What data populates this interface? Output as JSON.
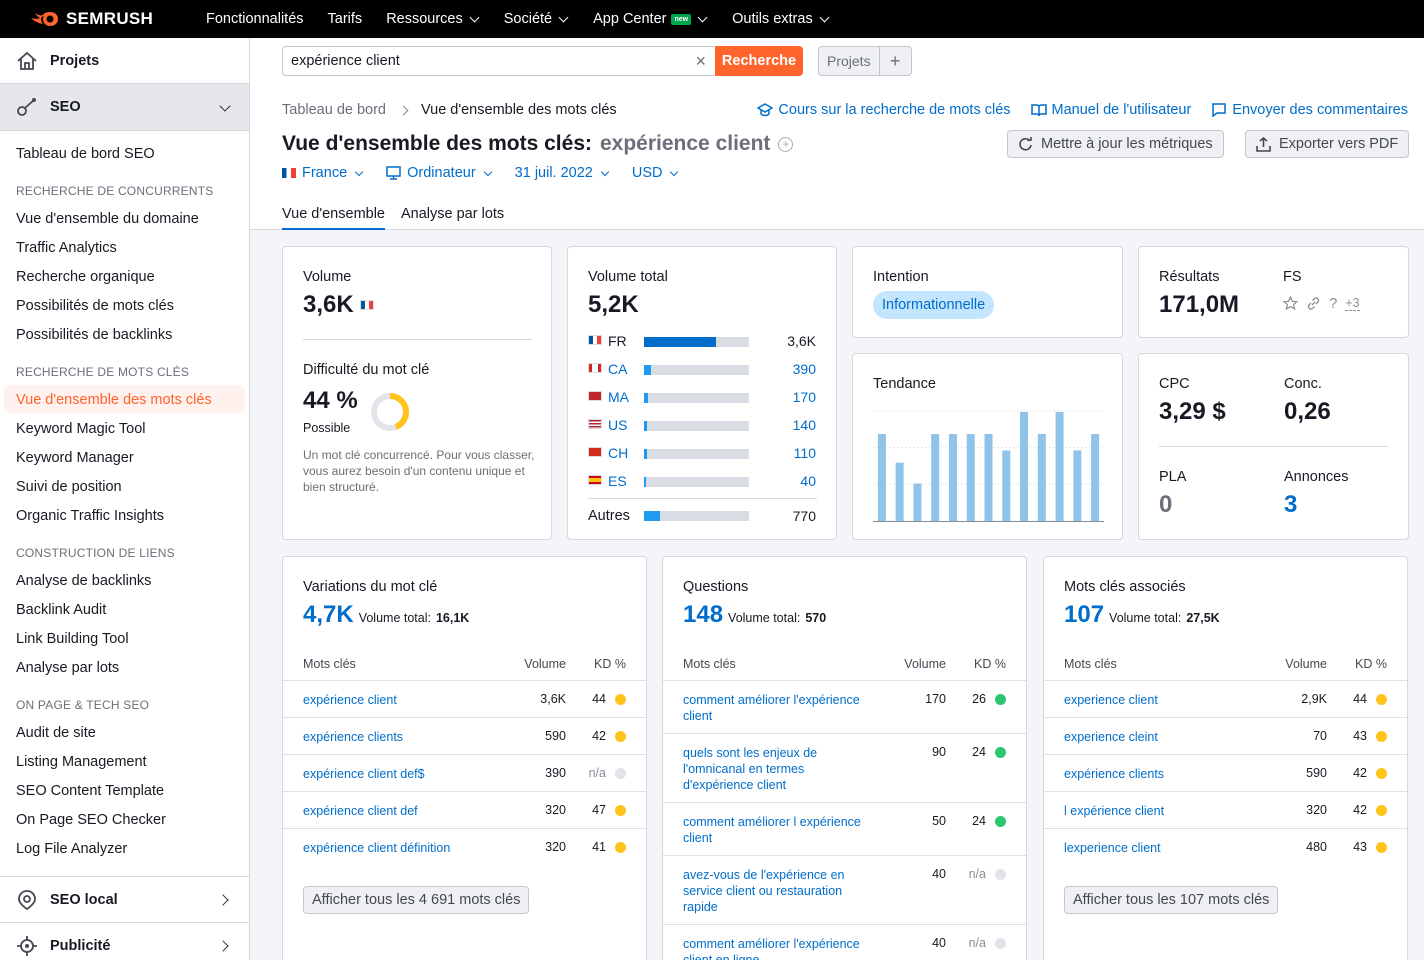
{
  "topbar": {
    "logo": "SEMRUSH",
    "nav": [
      {
        "label": "Fonctionnalités",
        "dropdown": false
      },
      {
        "label": "Tarifs",
        "dropdown": false
      },
      {
        "label": "Ressources",
        "dropdown": true
      },
      {
        "label": "Société",
        "dropdown": true
      },
      {
        "label": "App Center",
        "dropdown": true,
        "badge": "new"
      },
      {
        "label": "Outils extras",
        "dropdown": true
      }
    ]
  },
  "sidebar": {
    "projects": "Projets",
    "seo": "SEO",
    "dashboard": "Tableau de bord SEO",
    "groups": [
      {
        "title": "RECHERCHE DE CONCURRENTS",
        "items": [
          "Vue d'ensemble du domaine",
          "Traffic Analytics",
          "Recherche organique",
          "Possibilités de mots clés",
          "Possibilités de backlinks"
        ]
      },
      {
        "title": "RECHERCHE DE MOTS CLÉS",
        "items": [
          "Vue d'ensemble des mots clés",
          "Keyword Magic Tool",
          "Keyword Manager",
          "Suivi de position",
          "Organic Traffic Insights"
        ]
      },
      {
        "title": "CONSTRUCTION DE LIENS",
        "items": [
          "Analyse de backlinks",
          "Backlink Audit",
          "Link Building Tool",
          "Analyse par lots"
        ]
      },
      {
        "title": "ON PAGE & TECH SEO",
        "items": [
          "Audit de site",
          "Listing Management",
          "SEO Content Template",
          "On Page SEO Checker",
          "Log File Analyzer"
        ]
      }
    ],
    "active_item": "Vue d'ensemble des mots clés",
    "local_seo": "SEO local",
    "ads": "Publicité"
  },
  "search": {
    "value": "expérience client",
    "button": "Recherche",
    "projects": "Projets",
    "plus": "+"
  },
  "breadcrumb": {
    "root": "Tableau de bord",
    "current": "Vue d'ensemble des mots clés"
  },
  "toplinks": {
    "course": "Cours sur la recherche de mots clés",
    "manual": "Manuel de l'utilisateur",
    "feedback": "Envoyer des commentaires"
  },
  "title": {
    "prefix": "Vue d'ensemble des mots clés:",
    "keyword": "expérience client"
  },
  "buttons": {
    "update": "Mettre à jour les métriques",
    "export": "Exporter vers PDF"
  },
  "filters": {
    "country": "France",
    "device": "Ordinateur",
    "date": "31 juil. 2022",
    "currency": "USD"
  },
  "tabs": [
    "Vue d'ensemble",
    "Analyse par lots"
  ],
  "volume": {
    "label": "Volume",
    "value": "3,6K",
    "kd_label": "Difficulté du mot clé",
    "kd_value": "44 %",
    "kd_percent": 44,
    "kd_desc": "Possible",
    "kd_text": "Un mot clé concurrencé. Pour vous classer, vous aurez besoin d'un contenu unique et bien structuré."
  },
  "total_volume": {
    "label": "Volume total",
    "value": "5,2K",
    "countries": [
      {
        "code": "FR",
        "value": "3,6K",
        "share": 0.69
      },
      {
        "code": "CA",
        "value": "390",
        "share": 0.07
      },
      {
        "code": "MA",
        "value": "170",
        "share": 0.035
      },
      {
        "code": "US",
        "value": "140",
        "share": 0.03
      },
      {
        "code": "CH",
        "value": "110",
        "share": 0.025
      },
      {
        "code": "ES",
        "value": "40",
        "share": 0.015
      }
    ],
    "others_label": "Autres",
    "others_value": "770",
    "others_share": 0.15
  },
  "intent": {
    "label": "Intention",
    "value": "Informationnelle"
  },
  "results": {
    "label": "Résultats",
    "value": "171,0M",
    "fs_label": "FS",
    "fs_more": "+3"
  },
  "trend": {
    "label": "Tendance",
    "values": [
      0.8,
      0.54,
      0.35,
      0.8,
      0.8,
      0.8,
      0.8,
      0.65,
      1.0,
      0.8,
      1.0,
      0.65,
      0.8
    ]
  },
  "cpc": {
    "cpc_label": "CPC",
    "cpc_value": "3,29 $",
    "conc_label": "Conc.",
    "conc_value": "0,26",
    "pla_label": "PLA",
    "pla_value": "0",
    "ads_label": "Annonces",
    "ads_value": "3"
  },
  "colors": {
    "accent": "#ff642d",
    "link": "#006dca",
    "yellow": "#ffc31c",
    "green": "#2ac670",
    "grey": "#e2e4e9",
    "bar_light": "#8fc3ea"
  },
  "panels": [
    {
      "title": "Variations du mot clé",
      "count": "4,7K",
      "total_label": "Volume total:",
      "total": "16,1K",
      "headers": {
        "kw": "Mots clés",
        "vol": "Volume",
        "kd": "KD %"
      },
      "rows": [
        {
          "kw": "expérience client",
          "vol": "3,6K",
          "kd": "44",
          "kd_color": "yellow"
        },
        {
          "kw": "expérience clients",
          "vol": "590",
          "kd": "42",
          "kd_color": "yellow"
        },
        {
          "kw": "expérience client def$",
          "vol": "390",
          "kd": "n/a",
          "kd_color": "grey"
        },
        {
          "kw": "expérience client def",
          "vol": "320",
          "kd": "47",
          "kd_color": "yellow"
        },
        {
          "kw": "expérience client définition",
          "vol": "320",
          "kd": "41",
          "kd_color": "yellow"
        }
      ],
      "button": "Afficher tous les 4 691 mots clés"
    },
    {
      "title": "Questions",
      "count": "148",
      "total_label": "Volume total:",
      "total": "570",
      "headers": {
        "kw": "Mots clés",
        "vol": "Volume",
        "kd": "KD %"
      },
      "rows": [
        {
          "kw": "comment améliorer l'expérience client",
          "vol": "170",
          "kd": "26",
          "kd_color": "green"
        },
        {
          "kw": "quels sont les enjeux de l'omnicanal en termes d'expérience client",
          "vol": "90",
          "kd": "24",
          "kd_color": "green"
        },
        {
          "kw": "comment améliorer l expérience client",
          "vol": "50",
          "kd": "24",
          "kd_color": "green"
        },
        {
          "kw": "avez-vous de l'expérience en service client ou restauration rapide",
          "vol": "40",
          "kd": "n/a",
          "kd_color": "grey"
        },
        {
          "kw": "comment améliorer l'expérience client en ligne",
          "vol": "40",
          "kd": "n/a",
          "kd_color": "grey"
        }
      ]
    },
    {
      "title": "Mots clés associés",
      "count": "107",
      "total_label": "Volume total:",
      "total": "27,5K",
      "headers": {
        "kw": "Mots clés",
        "vol": "Volume",
        "kd": "KD %"
      },
      "rows": [
        {
          "kw": "experience client",
          "vol": "2,9K",
          "kd": "44",
          "kd_color": "yellow"
        },
        {
          "kw": "experience cleint",
          "vol": "70",
          "kd": "43",
          "kd_color": "yellow"
        },
        {
          "kw": "expérience clients",
          "vol": "590",
          "kd": "42",
          "kd_color": "yellow"
        },
        {
          "kw": "l expérience client",
          "vol": "320",
          "kd": "42",
          "kd_color": "yellow"
        },
        {
          "kw": "lexperience client",
          "vol": "480",
          "kd": "43",
          "kd_color": "yellow"
        }
      ],
      "button": "Afficher tous les 107 mots clés"
    }
  ]
}
